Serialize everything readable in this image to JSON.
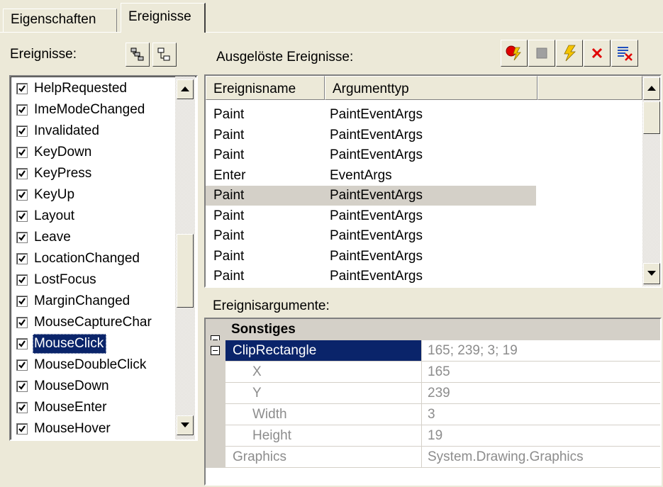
{
  "tabs": [
    {
      "label": "Eigenschaften"
    },
    {
      "label": "Ereignisse"
    }
  ],
  "left": {
    "label": "Ereignisse:",
    "items": [
      {
        "label": "HelpRequested",
        "checked": true
      },
      {
        "label": "ImeModeChanged",
        "checked": true
      },
      {
        "label": "Invalidated",
        "checked": true
      },
      {
        "label": "KeyDown",
        "checked": true
      },
      {
        "label": "KeyPress",
        "checked": true
      },
      {
        "label": "KeyUp",
        "checked": true
      },
      {
        "label": "Layout",
        "checked": true
      },
      {
        "label": "Leave",
        "checked": true
      },
      {
        "label": "LocationChanged",
        "checked": true
      },
      {
        "label": "LostFocus",
        "checked": true
      },
      {
        "label": "MarginChanged",
        "checked": true
      },
      {
        "label": "MouseCaptureChar",
        "checked": true
      },
      {
        "label": "MouseClick",
        "checked": true,
        "selected": true
      },
      {
        "label": "MouseDoubleClick",
        "checked": true
      },
      {
        "label": "MouseDown",
        "checked": true
      },
      {
        "label": "MouseEnter",
        "checked": true
      },
      {
        "label": "MouseHover",
        "checked": true
      }
    ]
  },
  "right": {
    "label": "Ausgelöste Ereignisse:",
    "columns": [
      "Ereignisname",
      "Argumenttyp"
    ],
    "rows": [
      [
        "Paint",
        "PaintEventArgs"
      ],
      [
        "Paint",
        "PaintEventArgs"
      ],
      [
        "Paint",
        "PaintEventArgs"
      ],
      [
        "Enter",
        "EventArgs"
      ],
      [
        "Paint",
        "PaintEventArgs"
      ],
      [
        "Paint",
        "PaintEventArgs"
      ],
      [
        "Paint",
        "PaintEventArgs"
      ],
      [
        "Paint",
        "PaintEventArgs"
      ],
      [
        "Paint",
        "PaintEventArgs"
      ]
    ],
    "highlighted_row": 4
  },
  "args": {
    "label": "Ereignisargumente:",
    "category": "Sonstiges",
    "props": [
      {
        "name": "ClipRectangle",
        "value": "165; 239; 3; 19"
      },
      {
        "name": "X",
        "value": "165"
      },
      {
        "name": "Y",
        "value": "239"
      },
      {
        "name": "Width",
        "value": "3"
      },
      {
        "name": "Height",
        "value": "19"
      },
      {
        "name": "Graphics",
        "value": "System.Drawing.Graphics"
      }
    ]
  },
  "icons": {
    "categorize": "categorized-icon",
    "alphabetical": "alphabetical-icon",
    "record": "record-icon",
    "stop": "stop-icon",
    "lightning": "lightning-icon",
    "delete": "delete-icon",
    "clear": "clear-list-icon"
  },
  "colors": {
    "selection": "#0a246a",
    "window_bg": "#ece9d8",
    "delete_red": "#e00000",
    "lightning_yellow": "#f5c400"
  }
}
